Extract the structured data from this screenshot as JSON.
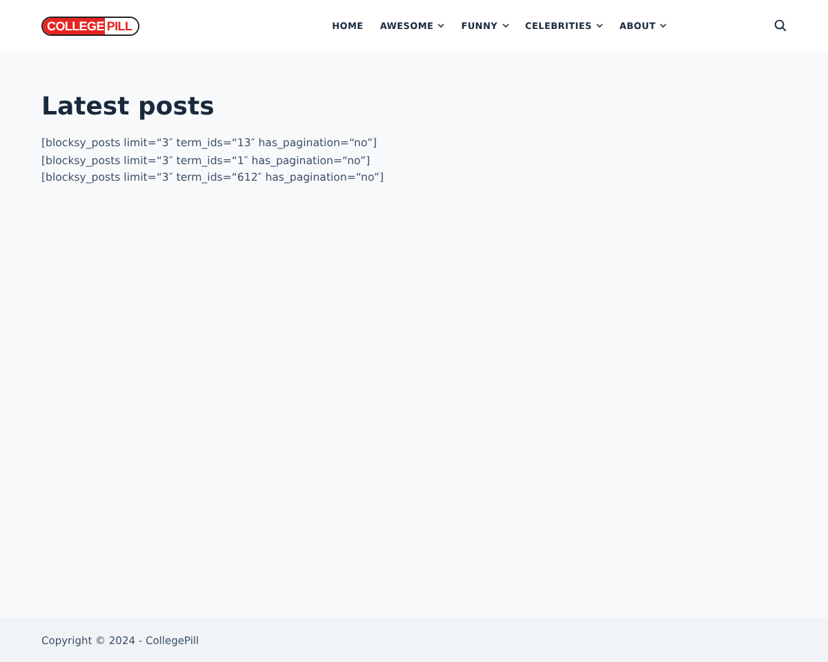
{
  "logo": {
    "left": "COLLEGE",
    "right": "PILL"
  },
  "nav": [
    {
      "label": "HOME",
      "dropdown": false
    },
    {
      "label": "AWESOME",
      "dropdown": true
    },
    {
      "label": "FUNNY",
      "dropdown": true
    },
    {
      "label": "CELEBRITIES",
      "dropdown": true
    },
    {
      "label": "ABOUT",
      "dropdown": true
    }
  ],
  "page": {
    "title": "Latest posts",
    "lines": [
      "[blocksy_posts limit=“3″ term_ids=“13″ has_pagination=“no”]",
      "[blocksy_posts limit=“3″ term_ids=“1″ has_pagination=“no”]",
      "[blocksy_posts limit=“3″ term_ids=“612″ has_pagination=“no”]"
    ]
  },
  "footer": {
    "copyright": "Copyright © 2024 - CollegePill"
  }
}
